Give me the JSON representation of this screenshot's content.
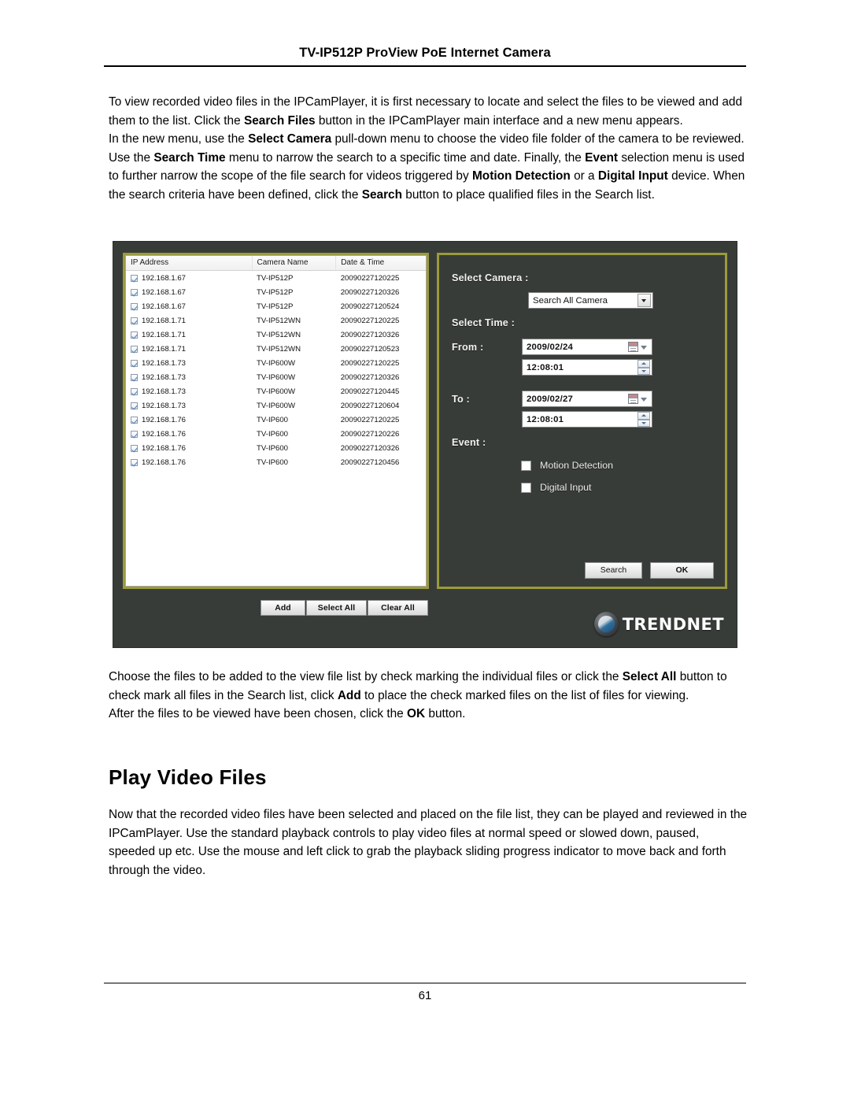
{
  "header": {
    "title": "TV-IP512P ProView PoE Internet Camera"
  },
  "footer": {
    "page_number": "61"
  },
  "paragraphs": {
    "intro_1a": "To view recorded video files in the IPCamPlayer, it is first necessary to locate and select the files to be viewed and add them to the list. Click the ",
    "intro_1b": "Search Files",
    "intro_1c": " button in the IPCamPlayer main interface and a new menu appears.",
    "intro_2a": "In the new menu, use the ",
    "intro_2b": "Select Camera",
    "intro_2c": " pull-down menu to choose the video file folder of the camera to be reviewed. Use the ",
    "intro_2d": "Search Time",
    "intro_2e": " menu to narrow the search to a specific time and date. Finally, the ",
    "intro_2f": "Event",
    "intro_2g": " selection menu is used to further narrow the scope of the file search for videos triggered by ",
    "intro_2h": "Motion Detection",
    "intro_2i": " or a ",
    "intro_2j": "Digital Input",
    "intro_2k": " device. When the search criteria have been defined, click the ",
    "intro_2l": "Search",
    "intro_2m": " button to place qualified files in the Search list.",
    "after_1a": "Choose the files to be added to the view file list by check marking the individual files or click the ",
    "after_1b": "Select All",
    "after_1c": " button to check mark all files in the Search list, click ",
    "after_1d": "Add",
    "after_1e": " to place the check marked files on the list of files for viewing.",
    "after_2a": "After the files to be viewed have been chosen, click the ",
    "after_2b": "OK",
    "after_2c": " button.",
    "play_body": "Now that the recorded video files have been selected and placed on the file list, they can be played and reviewed in the IPCamPlayer.  Use the standard playback controls to play video files at normal speed or slowed down, paused, speeded up etc. Use the mouse and left click to grab the playback sliding progress indicator to move back and forth through the video."
  },
  "section": {
    "play_video_files_heading": "Play Video Files"
  },
  "app": {
    "colors": {
      "window_background": "#383c38",
      "panel_border": "#9a9a3c",
      "label_text": "#f2f2f2",
      "field_background": "#ffffff"
    },
    "file_list": {
      "columns": [
        "IP Address",
        "Camera Name",
        "Date & Time"
      ],
      "rows": [
        {
          "checked": true,
          "ip": "192.168.1.67",
          "camera": "TV-IP512P",
          "datetime": "20090227120225"
        },
        {
          "checked": true,
          "ip": "192.168.1.67",
          "camera": "TV-IP512P",
          "datetime": "20090227120326"
        },
        {
          "checked": true,
          "ip": "192.168.1.67",
          "camera": "TV-IP512P",
          "datetime": "20090227120524"
        },
        {
          "checked": true,
          "ip": "192.168.1.71",
          "camera": "TV-IP512WN",
          "datetime": "20090227120225"
        },
        {
          "checked": true,
          "ip": "192.168.1.71",
          "camera": "TV-IP512WN",
          "datetime": "20090227120326"
        },
        {
          "checked": true,
          "ip": "192.168.1.71",
          "camera": "TV-IP512WN",
          "datetime": "20090227120523"
        },
        {
          "checked": true,
          "ip": "192.168.1.73",
          "camera": "TV-IP600W",
          "datetime": "20090227120225"
        },
        {
          "checked": true,
          "ip": "192.168.1.73",
          "camera": "TV-IP600W",
          "datetime": "20090227120326"
        },
        {
          "checked": true,
          "ip": "192.168.1.73",
          "camera": "TV-IP600W",
          "datetime": "20090227120445"
        },
        {
          "checked": true,
          "ip": "192.168.1.73",
          "camera": "TV-IP600W",
          "datetime": "20090227120604"
        },
        {
          "checked": true,
          "ip": "192.168.1.76",
          "camera": "TV-IP600",
          "datetime": "20090227120225"
        },
        {
          "checked": true,
          "ip": "192.168.1.76",
          "camera": "TV-IP600",
          "datetime": "20090227120226"
        },
        {
          "checked": true,
          "ip": "192.168.1.76",
          "camera": "TV-IP600",
          "datetime": "20090227120326"
        },
        {
          "checked": true,
          "ip": "192.168.1.76",
          "camera": "TV-IP600",
          "datetime": "20090227120456"
        }
      ]
    },
    "config": {
      "select_camera_label": "Select Camera :",
      "camera_value": "Search All Camera",
      "select_time_label": "Select Time :",
      "from_label": "From :",
      "from_date": "2009/02/24",
      "from_time": "12:08:01",
      "to_label": "To :",
      "to_date": "2009/02/27",
      "to_time": "12:08:01",
      "event_label": "Event :",
      "events": [
        {
          "label": "Motion Detection",
          "checked": false
        },
        {
          "label": "Digital Input",
          "checked": false
        }
      ],
      "search_button": "Search",
      "ok_button": "OK"
    },
    "list_buttons": {
      "add": "Add",
      "select_all": "Select All",
      "clear_all": "Clear All"
    },
    "brand": {
      "name_upper": "TRENDN",
      "name_suffix": "ET",
      "full": "TRENDnet"
    }
  }
}
